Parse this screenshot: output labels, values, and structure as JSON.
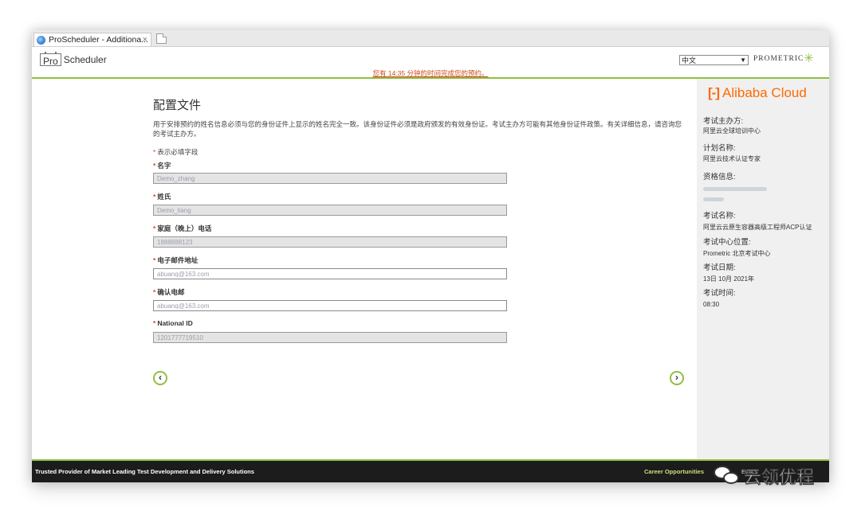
{
  "browser": {
    "tab_title": "ProScheduler - Additiona...",
    "tab_close": "×"
  },
  "header": {
    "logo_pro": "Pro",
    "logo_scheduler": "Scheduler",
    "timer_text": "您有 14:35 分钟的时间完成您的预约。",
    "language_selected": "中文",
    "brand": "PROMETRIC"
  },
  "form": {
    "title": "配置文件",
    "intro": "用于安排预约的姓名信息必须与您的身份证件上显示的姓名完全一致。该身份证件必须是政府颁发的有效身份证。考试主办方可能有其他身份证件政策。有关详细信息，请咨询您的考试主办方。",
    "required_marker": "*",
    "required_note": "表示必填字段",
    "fields": [
      {
        "label": "名字",
        "value": "Demo_zhang"
      },
      {
        "label": "姓氏",
        "value": "Demo_liang"
      },
      {
        "label": "家庭（晚上）电话",
        "value": "1888888123"
      },
      {
        "label": "电子邮件地址",
        "value": "abuanq@163.com"
      },
      {
        "label": "确认电邮",
        "value": "abuanq@163.com"
      },
      {
        "label": "National ID",
        "value": "1201777719510"
      }
    ],
    "prev_symbol": "‹",
    "next_symbol": "›"
  },
  "sidebar": {
    "brand_mark": "[-]",
    "brand_name": "Alibaba Cloud",
    "sponsor_label": "考试主办方:",
    "sponsor_value": "阿里云全球培训中心",
    "program_label": "计划名称:",
    "program_value": "阿里云技术认证专家",
    "eligibility_label": "资格信息:",
    "exam_label": "考试名称:",
    "exam_value": "阿里云云原生容器高级工程师ACP认证",
    "center_label": "考试中心位置:",
    "center_value": "Prometric 北京考试中心",
    "date_label": "考试日期:",
    "date_value": "13日 10月 2021年",
    "time_label": "考试时间:",
    "time_value": "08:30"
  },
  "footer": {
    "tagline": "Trusted Provider of Market Leading Test Development and Delivery Solutions",
    "career_link": "Career Opportunities",
    "ethics_link": "Ethics"
  },
  "watermark": {
    "text": "云领优程"
  },
  "colors": {
    "accent_green": "#8fc03f",
    "alert_orange": "#d04a1d",
    "alibaba_orange": "#ff6a00",
    "footer_bg": "#1c1c1c"
  }
}
